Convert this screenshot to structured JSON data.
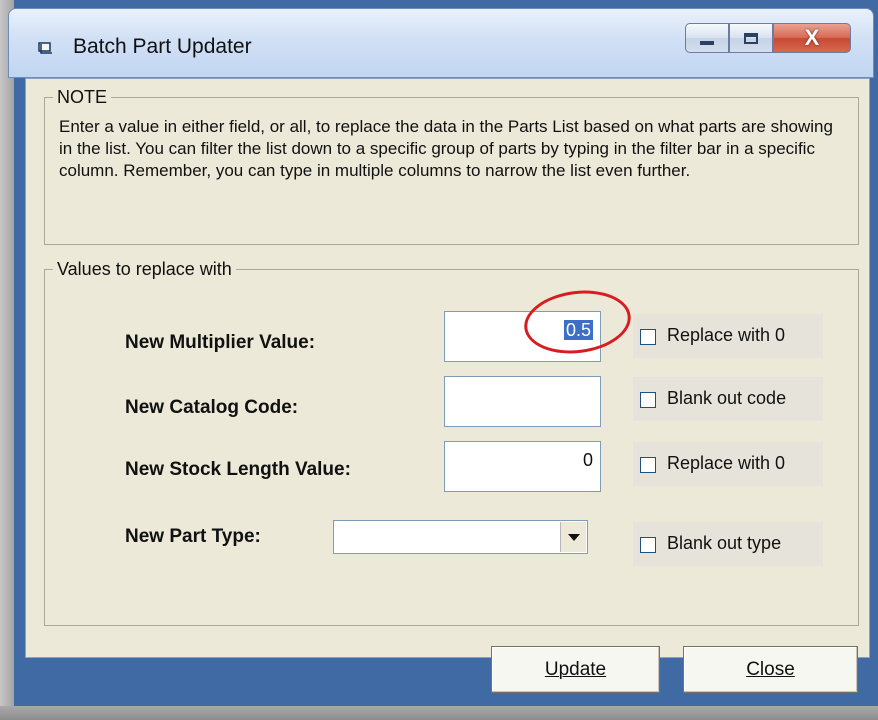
{
  "window": {
    "title": "Batch Part Updater",
    "minimize": "minimize",
    "maximize": "maximize",
    "close": "X"
  },
  "note": {
    "legend": "NOTE",
    "text": "Enter a value in either field, or all, to replace the data in the Parts List based on what parts are showing in the list. You can filter the list down to a specific group of parts by typing in the filter bar in a specific column. Remember, you can type in multiple columns to narrow the list even further."
  },
  "values": {
    "legend": "Values to replace with",
    "multiplier_label": "New Multiplier Value:",
    "multiplier_value": "0.5",
    "multiplier_check": "Replace with 0",
    "catalog_label": "New Catalog Code:",
    "catalog_value": "",
    "catalog_check": "Blank out code",
    "stock_label": "New Stock Length Value:",
    "stock_value": "0",
    "stock_check": "Replace with 0",
    "part_type_label": "New Part Type:",
    "part_type_value": "",
    "part_type_check": "Blank out type"
  },
  "buttons": {
    "update": "Update",
    "close": "Close"
  },
  "colors": {
    "frame": "#3f6aa3",
    "dialog": "#ece9d8",
    "highlight": "#d61e21",
    "selection": "#3d6fc4"
  },
  "icons": [
    "app-window-icon",
    "minimize-icon",
    "maximize-icon",
    "close-icon",
    "dropdown-arrow-icon"
  ]
}
